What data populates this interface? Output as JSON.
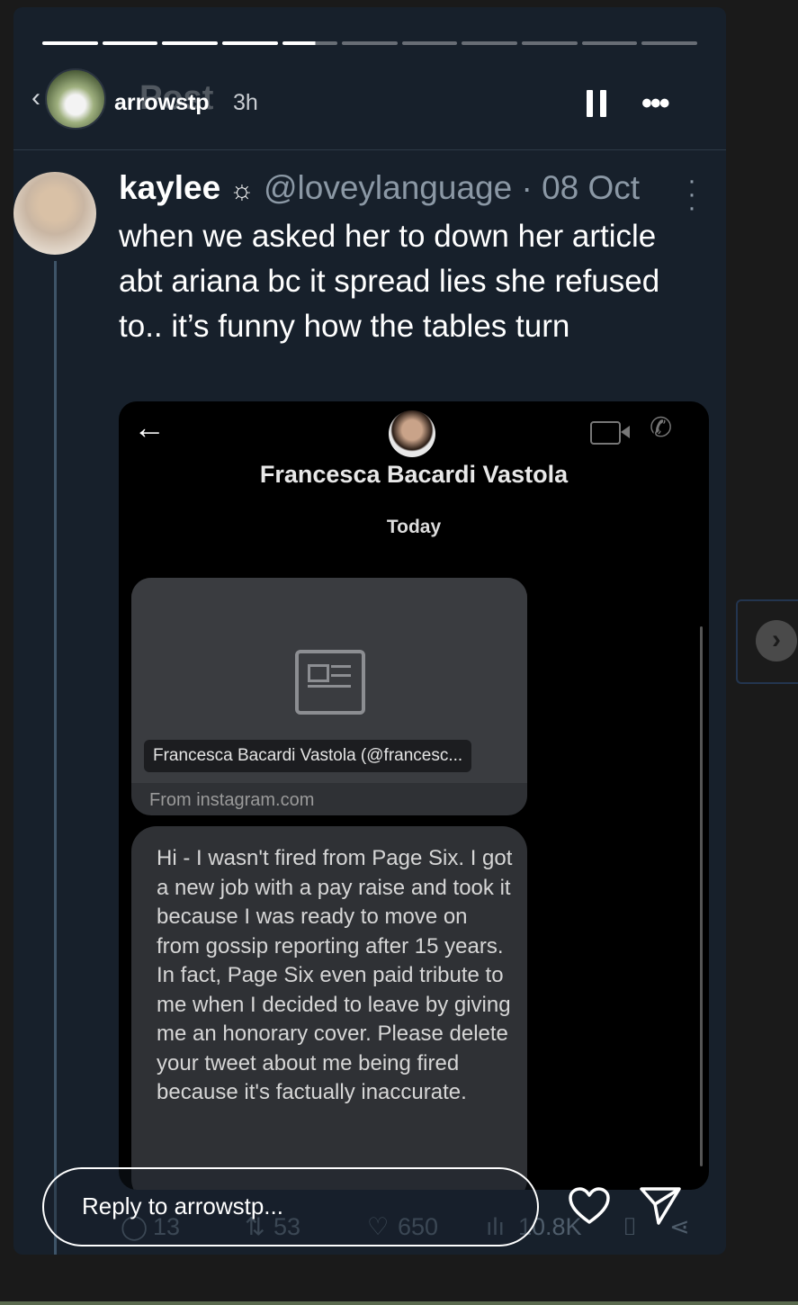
{
  "story": {
    "user": "arrowstp",
    "time": "3h",
    "ghost_title": "Post",
    "progress": {
      "segments": 11,
      "completed": 4,
      "current_fraction": 0.6
    }
  },
  "tweet": {
    "name": "kaylee",
    "badge_icon": "gear-icon",
    "handle_date": "@loveylanguage · 08 Oct",
    "text": "when we asked her to down her article abt ariana bc it spread lies she refused to.. it’s funny how the tables turn",
    "metrics": {
      "replies": "13",
      "reposts": "53",
      "likes": "650",
      "views": "10.8K"
    }
  },
  "screenshot": {
    "contact_name": "Francesca Bacardi Vastola",
    "date_label": "Today",
    "link_title": "Francesca Bacardi Vastola (@francesc...",
    "link_source": "From instagram.com",
    "message": "Hi - I wasn't fired from Page Six. I got a new job with a pay raise and took it because I was ready to move on from gossip reporting after 15 years. In fact, Page Six even paid tribute to me when I decided to leave by giving me an honorary cover. Please delete your tweet about me being fired because it's factually inaccurate."
  },
  "reply": {
    "placeholder": "Reply to arrowstp..."
  },
  "colors": {
    "background": "#17202b",
    "handle": "#8b98a5",
    "bubble": "#2f3135"
  }
}
